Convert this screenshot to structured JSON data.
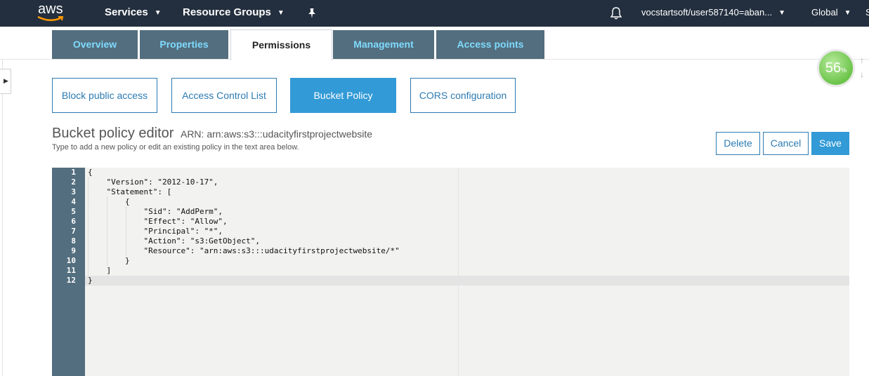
{
  "topnav": {
    "logo_text": "aws",
    "services": "Services",
    "resource_groups": "Resource Groups",
    "account": "vocstartsoft/user587140=aban...",
    "region": "Global",
    "partial": "S"
  },
  "tabs": [
    {
      "label": "Overview"
    },
    {
      "label": "Properties"
    },
    {
      "label": "Permissions"
    },
    {
      "label": "Management"
    },
    {
      "label": "Access points"
    }
  ],
  "subtabs": [
    {
      "label": "Block public access"
    },
    {
      "label": "Access Control List"
    },
    {
      "label": "Bucket Policy"
    },
    {
      "label": "CORS configuration"
    }
  ],
  "editor": {
    "title": "Bucket policy editor",
    "arn": "ARN: arn:aws:s3:::udacityfirstprojectwebsite",
    "subtitle": "Type to add a new policy or edit an existing policy in the text area below.",
    "lines": [
      {
        "n": "1",
        "text": "{"
      },
      {
        "n": "2",
        "text": "    \"Version\": \"2012-10-17\","
      },
      {
        "n": "3",
        "text": "    \"Statement\": ["
      },
      {
        "n": "4",
        "text": "        {"
      },
      {
        "n": "5",
        "text": "            \"Sid\": \"AddPerm\","
      },
      {
        "n": "6",
        "text": "            \"Effect\": \"Allow\","
      },
      {
        "n": "7",
        "text": "            \"Principal\": \"*\","
      },
      {
        "n": "8",
        "text": "            \"Action\": \"s3:GetObject\","
      },
      {
        "n": "9",
        "text": "            \"Resource\": \"arn:aws:s3:::udacityfirstprojectwebsite/*\""
      },
      {
        "n": "10",
        "text": "        }"
      },
      {
        "n": "11",
        "text": "    ]"
      },
      {
        "n": "12",
        "text": "}"
      }
    ]
  },
  "buttons": {
    "delete": "Delete",
    "cancel": "Cancel",
    "save": "Save"
  },
  "badge": {
    "value": "56",
    "unit": "%"
  },
  "colors": {
    "nav_bg": "#232f3e",
    "tab_bg": "#536e7e",
    "tab_text": "#7fdbff",
    "accent": "#329ad6",
    "link": "#2c7bb3"
  }
}
